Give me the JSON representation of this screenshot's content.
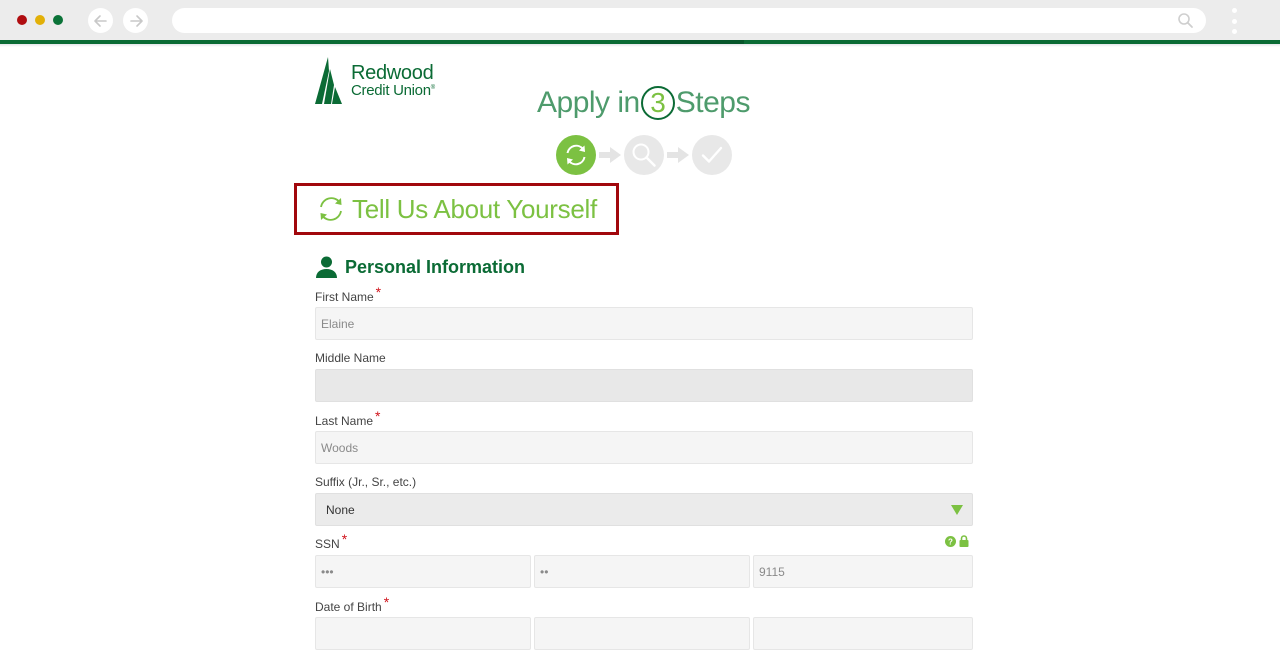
{
  "browser": {
    "address_value": "",
    "icons": [
      "arrow-left-icon",
      "arrow-right-icon",
      "search-icon",
      "kebab-menu-icon"
    ],
    "colors": {
      "close": "#b00d10",
      "minimize": "#e2b008",
      "maximize": "#0b7338",
      "accent_bar": "#0b6b35"
    }
  },
  "logo": {
    "line1": "Redwood",
    "line2": "Credit Union",
    "trademark": "®"
  },
  "apply": {
    "prefix": "Apply in",
    "number": "3",
    "suffix": "Steps"
  },
  "steps": [
    {
      "name": "Tell Us About Yourself",
      "icon": "refresh-icon",
      "active": true
    },
    {
      "name": "Review",
      "icon": "magnifier-icon",
      "active": false
    },
    {
      "name": "Complete",
      "icon": "checkmark-icon",
      "active": false
    }
  ],
  "section": {
    "title": "Tell Us About Yourself"
  },
  "personal_info": {
    "heading": "Personal Information",
    "fields": {
      "first_name": {
        "label": "First Name",
        "required": "*",
        "value": "Elaine"
      },
      "middle_name": {
        "label": "Middle Name",
        "value": ""
      },
      "last_name": {
        "label": "Last Name",
        "required": "*",
        "value": "Woods"
      },
      "suffix": {
        "label": "Suffix (Jr., Sr., etc.)",
        "value": "None"
      },
      "ssn": {
        "label": "SSN",
        "required": "*",
        "part1": "•••",
        "part2": "••",
        "part3": "9115"
      },
      "dob": {
        "label": "Date of Birth",
        "required": "*",
        "part1": "",
        "part2": "",
        "part3": ""
      }
    }
  },
  "colors": {
    "brand_dark_green": "#0b6b35",
    "brand_light_green": "#7cc142",
    "highlight_border": "#a1070c",
    "required": "#d0131b"
  }
}
